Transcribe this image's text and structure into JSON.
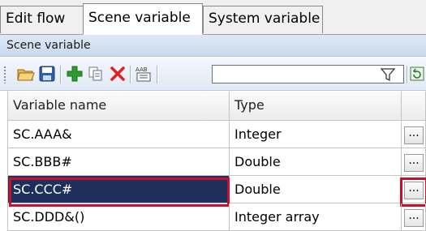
{
  "tabs": [
    {
      "label": "Edit flow",
      "active": false
    },
    {
      "label": "Scene variable",
      "active": true
    },
    {
      "label": "System variable",
      "active": false
    }
  ],
  "panel": {
    "title": "Scene variable"
  },
  "toolbar": {
    "buttons": [
      {
        "icon": "open-folder-icon"
      },
      {
        "icon": "save-icon"
      },
      {
        "icon": "add-icon"
      },
      {
        "icon": "copy-icon"
      },
      {
        "icon": "delete-icon"
      },
      {
        "icon": "rename-icon"
      }
    ],
    "filter_value": "",
    "filter_icon": "filter-icon",
    "refresh_icon": "refresh-icon"
  },
  "grid": {
    "columns": [
      "Variable name",
      "Type"
    ],
    "rows": [
      {
        "name": "SC.AAA&",
        "type": "Integer",
        "button": "..."
      },
      {
        "name": "SC.BBB#",
        "type": "Double",
        "button": "..."
      },
      {
        "name": "SC.CCC#",
        "type": "Double",
        "button": "...",
        "selected": true
      },
      {
        "name": "SC.DDD&()",
        "type": "Integer array",
        "button": "..."
      }
    ]
  },
  "colors": {
    "selection": "#1f2f5b",
    "highlight": "#c8102e",
    "header": "#dfe9f5"
  }
}
